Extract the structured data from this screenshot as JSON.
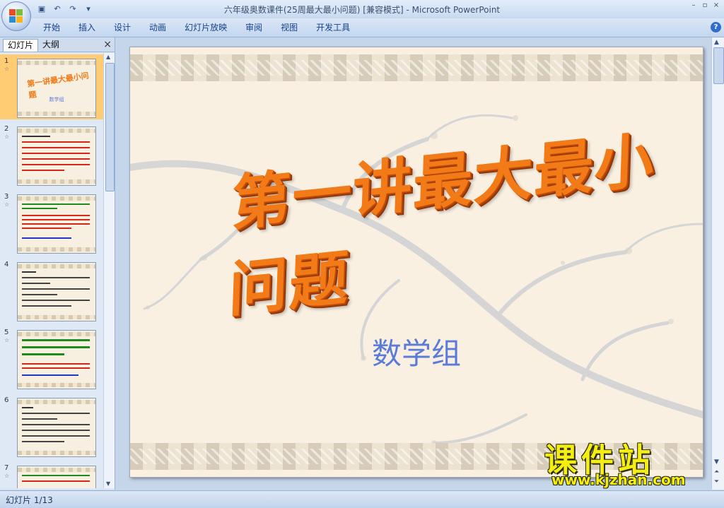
{
  "window": {
    "title": "六年级奥数课件(25周最大最小问题) [兼容模式] - Microsoft PowerPoint",
    "controls": [
      "–",
      "▫",
      "×"
    ]
  },
  "quick_access": [
    "save-icon",
    "undo-icon",
    "redo-icon",
    "customize-icon"
  ],
  "ribbon": {
    "tabs": [
      "开始",
      "插入",
      "设计",
      "动画",
      "幻灯片放映",
      "审阅",
      "视图",
      "开发工具"
    ],
    "help": "?"
  },
  "left_pane": {
    "tab_slides": "幻灯片",
    "tab_outline": "大纲",
    "close": "×",
    "thumbnails": [
      {
        "num": "1",
        "selected": true
      },
      {
        "num": "2",
        "selected": false
      },
      {
        "num": "3",
        "selected": false
      },
      {
        "num": "4",
        "selected": false
      },
      {
        "num": "5",
        "selected": false
      },
      {
        "num": "6",
        "selected": false
      },
      {
        "num": "7",
        "selected": false
      }
    ],
    "thumb1_title": "第一讲最大最小问题",
    "thumb1_sub": "数学组"
  },
  "slide": {
    "title": "第一讲最大最小问题",
    "subtitle": "数学组"
  },
  "status": {
    "slide_indicator": "幻灯片 1/13"
  },
  "watermark": {
    "brand": "课件站",
    "url": "www.kjzhan.com"
  },
  "colors": {
    "title_orange": "#f27a17",
    "subtitle_blue": "#5a7cd8",
    "selection": "#ffcb73"
  }
}
